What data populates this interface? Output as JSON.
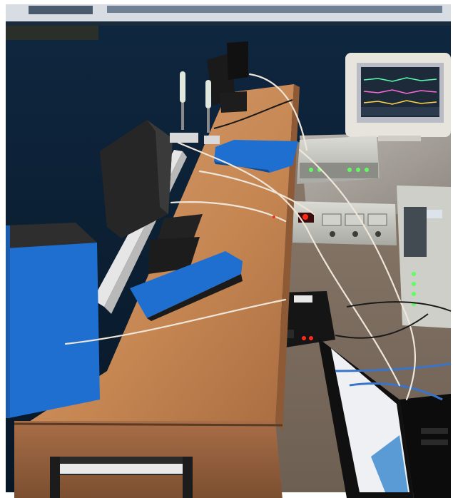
{
  "photo": {
    "palette": {
      "wall": "#0d2238",
      "bench_wood": "#c9875a",
      "blue_foam": "#1f6fd1",
      "black_foam": "#1e1e1e",
      "instrument_grey": "#c9c9c4",
      "monitor_screen": "#c8c8d0",
      "cable": "#efe6da",
      "led_green": "#5cff5c",
      "led_red": "#ff2a1a"
    }
  }
}
